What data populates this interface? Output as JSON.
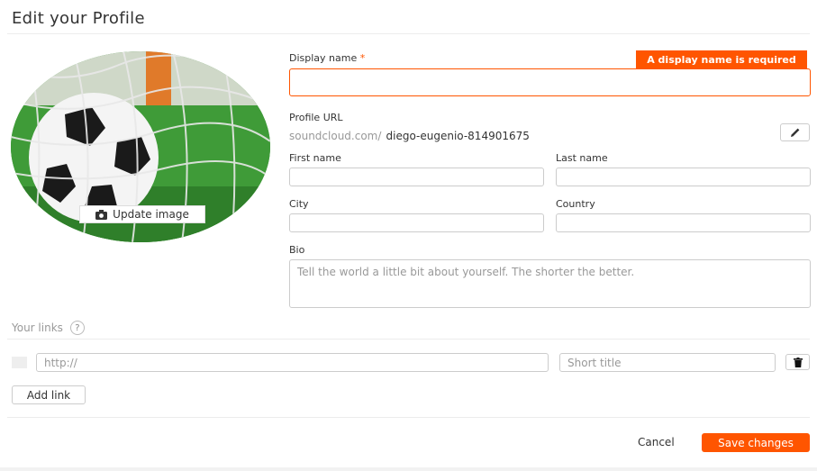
{
  "page": {
    "title": "Edit your Profile"
  },
  "avatar": {
    "update_label": "Update image",
    "icon": "camera-icon"
  },
  "display_name": {
    "label": "Display name",
    "required_marker": "*",
    "error": "A display name is required",
    "value": ""
  },
  "profile_url": {
    "label": "Profile URL",
    "prefix": "soundcloud.com/",
    "value": "diego-eugenio-814901675",
    "edit_icon": "pencil-icon"
  },
  "first_name": {
    "label": "First name",
    "value": ""
  },
  "last_name": {
    "label": "Last name",
    "value": ""
  },
  "city": {
    "label": "City",
    "value": ""
  },
  "country": {
    "label": "Country",
    "value": ""
  },
  "bio": {
    "label": "Bio",
    "placeholder": "Tell the world a little bit about yourself. The shorter the better."
  },
  "links": {
    "label": "Your links",
    "help": "?",
    "url_placeholder": "http://",
    "title_placeholder": "Short title",
    "delete_icon": "trash-icon",
    "add_label": "Add link"
  },
  "footer": {
    "cancel_label": "Cancel",
    "save_label": "Save changes"
  },
  "colors": {
    "accent": "#ff5500",
    "border": "#cccccc",
    "muted": "#999999"
  }
}
